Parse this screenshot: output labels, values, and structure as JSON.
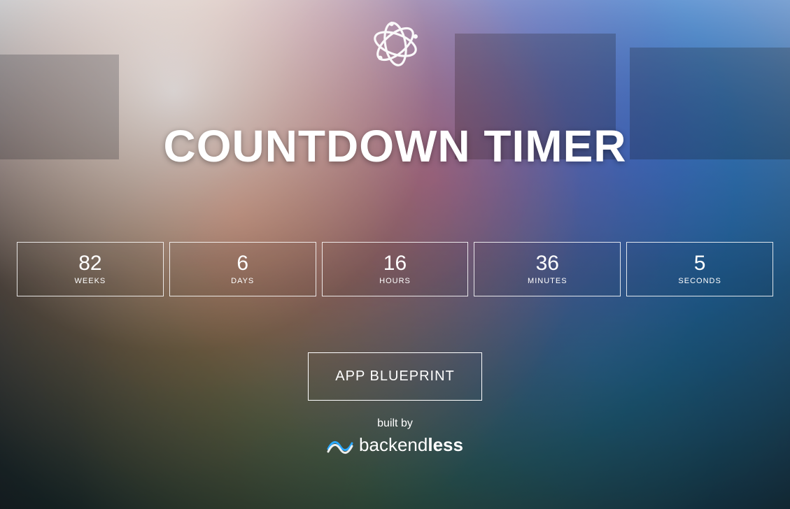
{
  "header": {
    "logo_name": "swirl-logo-icon",
    "title": "COUNTDOWN TIMER"
  },
  "countdown": {
    "units": [
      {
        "value": "82",
        "label": "WEEKS"
      },
      {
        "value": "6",
        "label": "DAYS"
      },
      {
        "value": "16",
        "label": "HOURS"
      },
      {
        "value": "36",
        "label": "MINUTES"
      },
      {
        "value": "5",
        "label": "SECONDS"
      }
    ]
  },
  "cta": {
    "label": "APP BLUEPRINT"
  },
  "footer": {
    "built_by": "built by",
    "brand_primary": "backend",
    "brand_secondary": "less"
  }
}
